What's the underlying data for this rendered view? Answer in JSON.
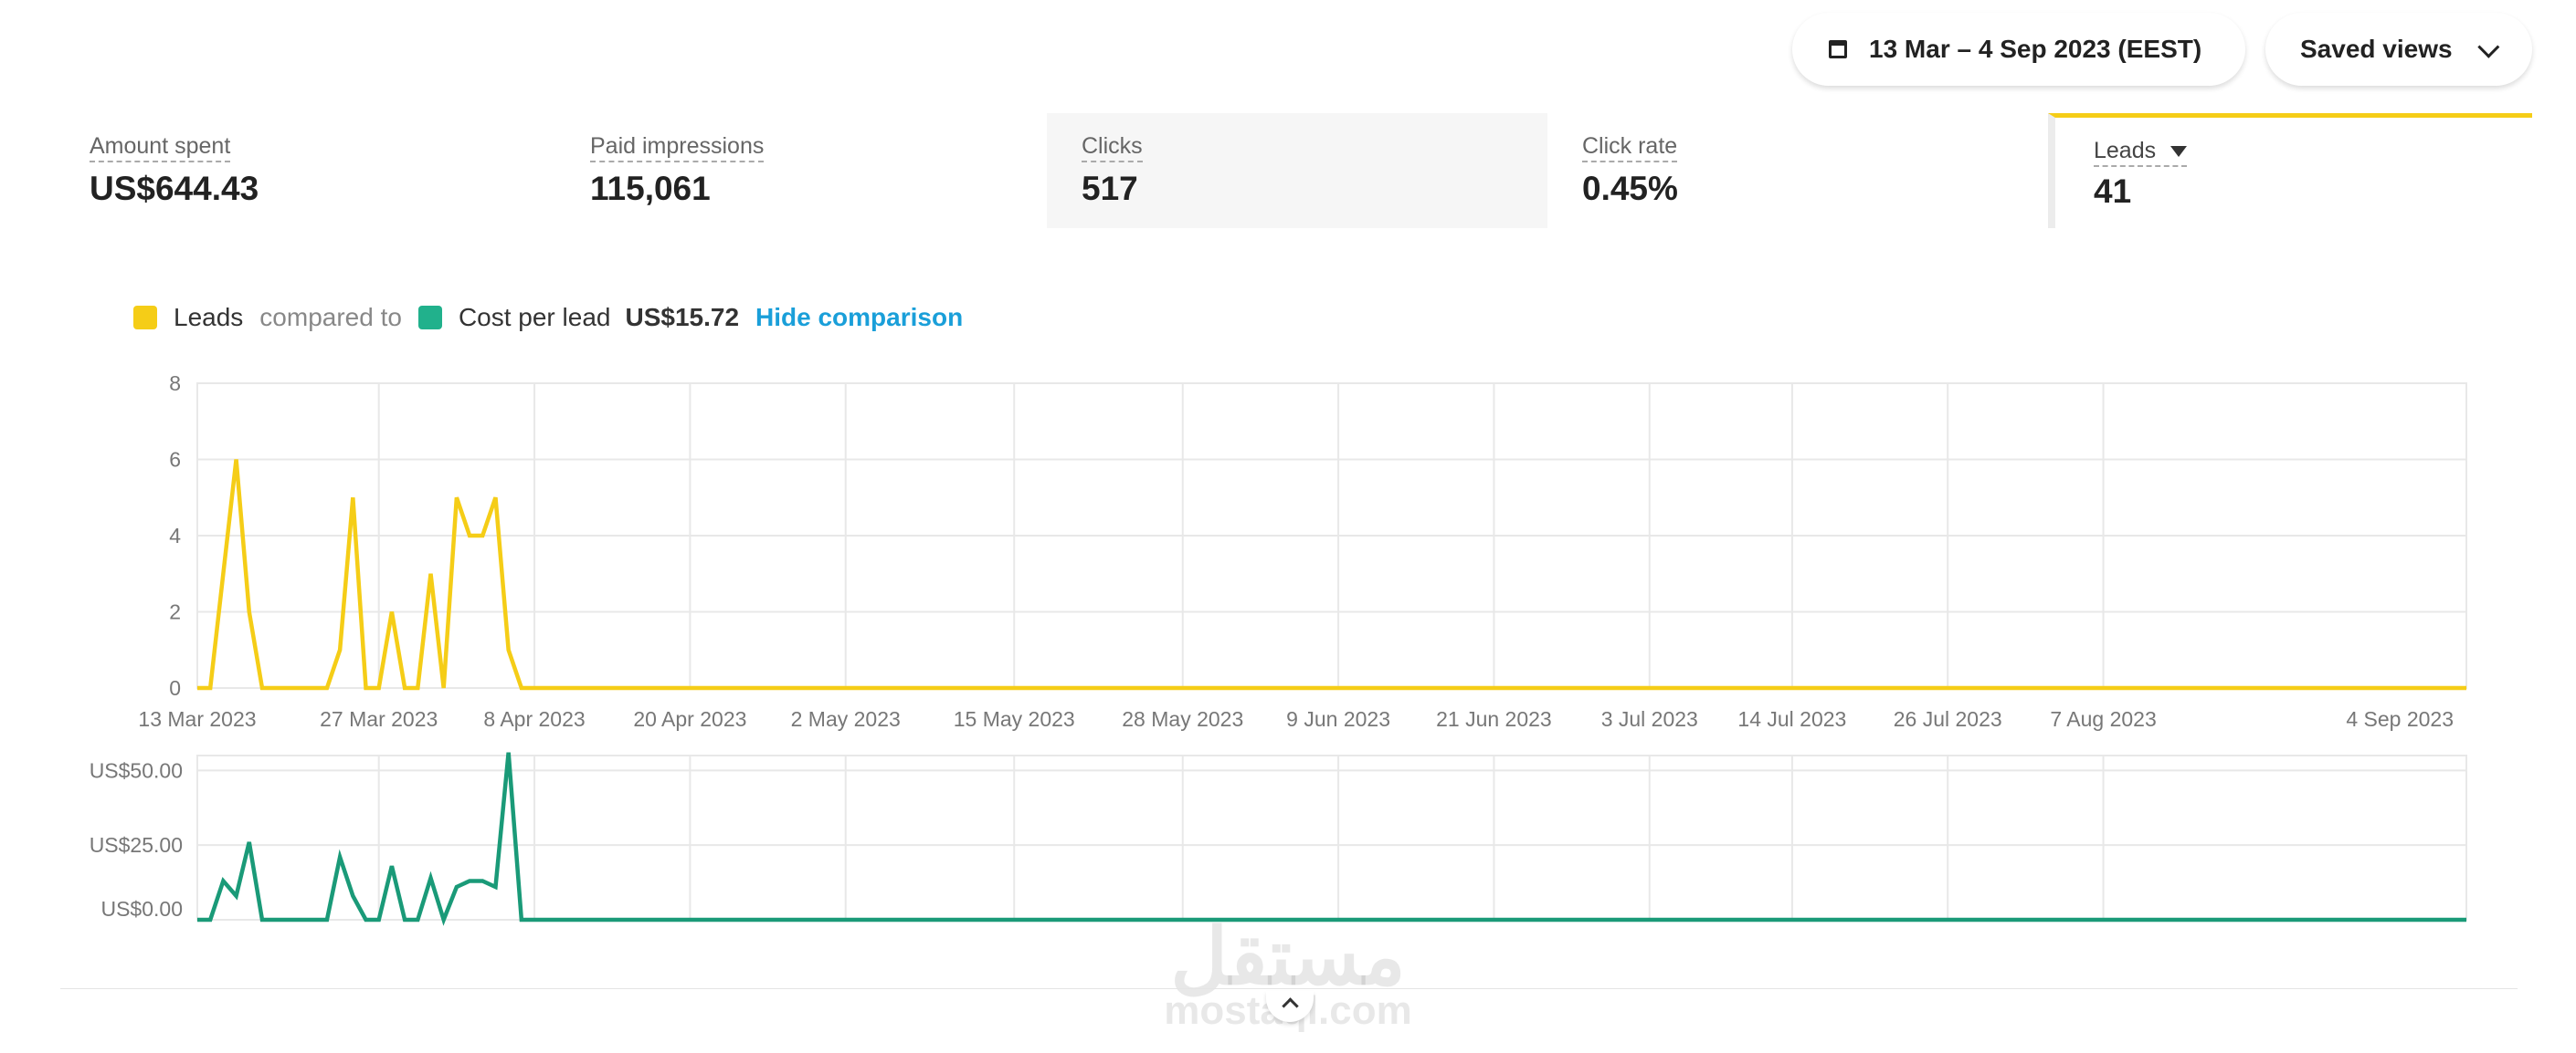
{
  "header": {
    "date_range": "13 Mar – 4 Sep 2023 (EEST)",
    "saved_views": "Saved views"
  },
  "metrics": [
    {
      "label": "Amount spent",
      "value": "US$644.43"
    },
    {
      "label": "Paid impressions",
      "value": "115,061"
    },
    {
      "label": "Clicks",
      "value": "517"
    },
    {
      "label": "Click rate",
      "value": "0.45%"
    },
    {
      "label": "Leads",
      "value": "41"
    }
  ],
  "legend": {
    "primary": "Leads",
    "compared_to": "compared to",
    "secondary": "Cost per lead",
    "secondary_value": "US$15.72",
    "hide": "Hide comparison"
  },
  "colors": {
    "leads": "#f5cd17",
    "cost": "#1a9a78",
    "cost_swatch": "#21b18c",
    "link": "#1a9fd9",
    "grid": "#e8e8e8"
  },
  "chart_data": [
    {
      "type": "line",
      "series": [
        {
          "name": "Leads",
          "x": [
            0,
            1,
            2,
            3,
            4,
            5,
            6,
            7,
            8,
            9,
            10,
            11,
            12,
            13,
            14,
            15,
            16,
            17,
            18,
            19,
            20,
            21,
            22,
            23,
            24,
            25,
            26,
            175
          ],
          "values": [
            0,
            0,
            3,
            6,
            2,
            0,
            0,
            0,
            0,
            0,
            0,
            1,
            5,
            0,
            0,
            2,
            0,
            0,
            3,
            0,
            5,
            4,
            4,
            5,
            1,
            0,
            0,
            0
          ]
        }
      ],
      "x_unit": "days since 13 Mar 2023",
      "x_range": [
        0,
        175
      ],
      "x_tick_labels": [
        "13 Mar 2023",
        "27 Mar 2023",
        "8 Apr 2023",
        "20 Apr 2023",
        "2 May 2023",
        "15 May 2023",
        "28 May 2023",
        "9 Jun 2023",
        "21 Jun 2023",
        "3 Jul 2023",
        "14 Jul 2023",
        "26 Jul 2023",
        "7 Aug 2023",
        "4 Sep 2023"
      ],
      "x_tick_values": [
        0,
        14,
        26,
        38,
        50,
        63,
        76,
        88,
        100,
        112,
        123,
        135,
        147,
        175
      ],
      "y_ticks": [
        "0",
        "2",
        "4",
        "6",
        "8"
      ],
      "ylim": [
        0,
        8
      ],
      "grid": true
    },
    {
      "type": "line",
      "series": [
        {
          "name": "Cost per lead",
          "x": [
            0,
            1,
            2,
            3,
            4,
            5,
            6,
            7,
            8,
            9,
            10,
            11,
            12,
            13,
            14,
            15,
            16,
            17,
            18,
            19,
            20,
            21,
            22,
            23,
            24,
            25,
            175
          ],
          "values": [
            0,
            0,
            13,
            8,
            26,
            0,
            0,
            0,
            0,
            0,
            0,
            21,
            8,
            0,
            0,
            18,
            0,
            0,
            14,
            0,
            11,
            13,
            13,
            11,
            56,
            0,
            0
          ]
        }
      ],
      "x_range": [
        0,
        175
      ],
      "y_ticks": [
        "US$0.00",
        "US$25.00",
        "US$50.00"
      ],
      "ylim": [
        0,
        55
      ],
      "grid": true
    }
  ],
  "watermark": {
    "arabic": "مستقل",
    "latin": "mostaql.com"
  }
}
